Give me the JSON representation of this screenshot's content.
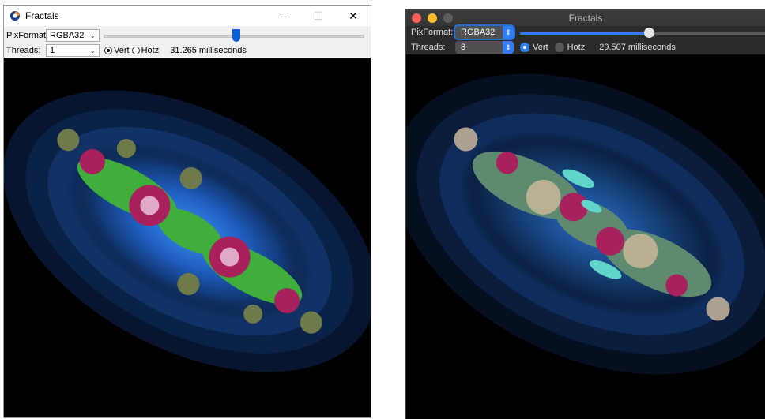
{
  "windows_app": {
    "title": "Fractals",
    "caption": {
      "minimize": "–",
      "maximize": "☐",
      "close": "✕"
    },
    "pixformat": {
      "label": "PixFormat:",
      "value": "RGBA32"
    },
    "threads": {
      "label": "Threads:",
      "value": "1"
    },
    "slider_level_percent": 51,
    "orientation": {
      "vert": "Vert",
      "hotz": "Hotz",
      "selected": "vert"
    },
    "timing": "31.265 milliseconds"
  },
  "mac_app": {
    "title": "Fractals",
    "pixformat": {
      "label": "PixFormat:",
      "value": "RGBA32"
    },
    "threads": {
      "label": "Threads:",
      "value": "8"
    },
    "slider_level_percent": 51,
    "orientation": {
      "vert": "Vert",
      "hotz": "Hotz",
      "selected": "vert"
    },
    "timing": "29.507 milliseconds"
  },
  "icons": {
    "chevron": "chevron-down-icon",
    "stepper": "up-down-stepper-icon",
    "app": "app-icon"
  },
  "colors": {
    "win_accent": "#0a60d6",
    "mac_accent": "#2f7df4",
    "fractal_glow": "#1e6fd6",
    "fractal_green": "#3fae3a",
    "fractal_magenta": "#a8205c"
  }
}
